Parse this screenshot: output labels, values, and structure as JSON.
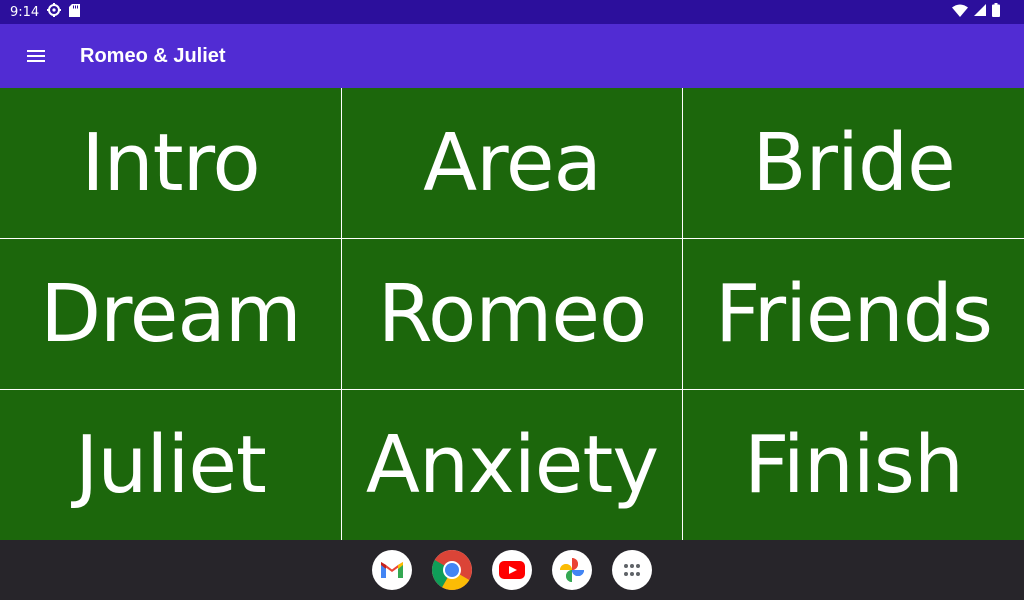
{
  "status_bar": {
    "time": "9:14",
    "icons": [
      "settings-gear-icon",
      "sd-card-icon",
      "wifi-icon",
      "signal-icon",
      "battery-icon"
    ]
  },
  "app_bar": {
    "title": "Romeo & Juliet",
    "menu_icon": "hamburger-menu-icon",
    "background": "#512cd3"
  },
  "grid": {
    "tile_color": "#1c670c",
    "tiles": [
      {
        "label": "Intro"
      },
      {
        "label": "Area"
      },
      {
        "label": "Bride"
      },
      {
        "label": "Dream"
      },
      {
        "label": "Romeo"
      },
      {
        "label": "Friends"
      },
      {
        "label": "Juliet"
      },
      {
        "label": "Anxiety"
      },
      {
        "label": "Finish"
      }
    ]
  },
  "dock": {
    "apps": [
      "gmail-icon",
      "chrome-icon",
      "youtube-icon",
      "photos-icon",
      "app-drawer-icon"
    ]
  }
}
